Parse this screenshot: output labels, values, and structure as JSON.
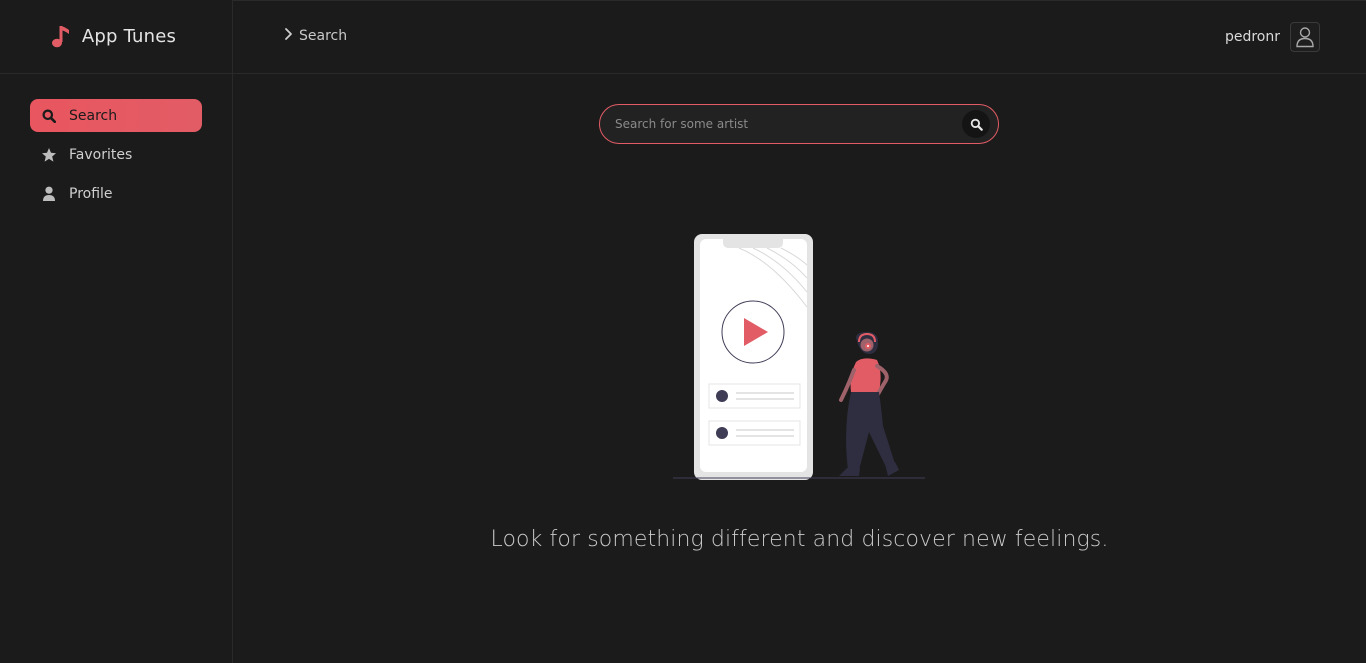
{
  "app": {
    "name": "App Tunes",
    "brand_color": "#e25c66",
    "logo_icon": "music-note-icon"
  },
  "sidebar": {
    "items": [
      {
        "label": "Search",
        "icon": "search-icon",
        "active": true
      },
      {
        "label": "Favorites",
        "icon": "star-icon",
        "active": false
      },
      {
        "label": "Profile",
        "icon": "user-icon",
        "active": false
      }
    ]
  },
  "header": {
    "breadcrumb": "Search",
    "breadcrumb_icon": "chevron-right-icon",
    "username": "pedronr",
    "avatar_icon": "user-outline-icon"
  },
  "main": {
    "search": {
      "placeholder": "Search for some artist",
      "value": ""
    },
    "illustration": "person-listening-music-phone",
    "tagline": "Look for something different and discover new feelings."
  }
}
